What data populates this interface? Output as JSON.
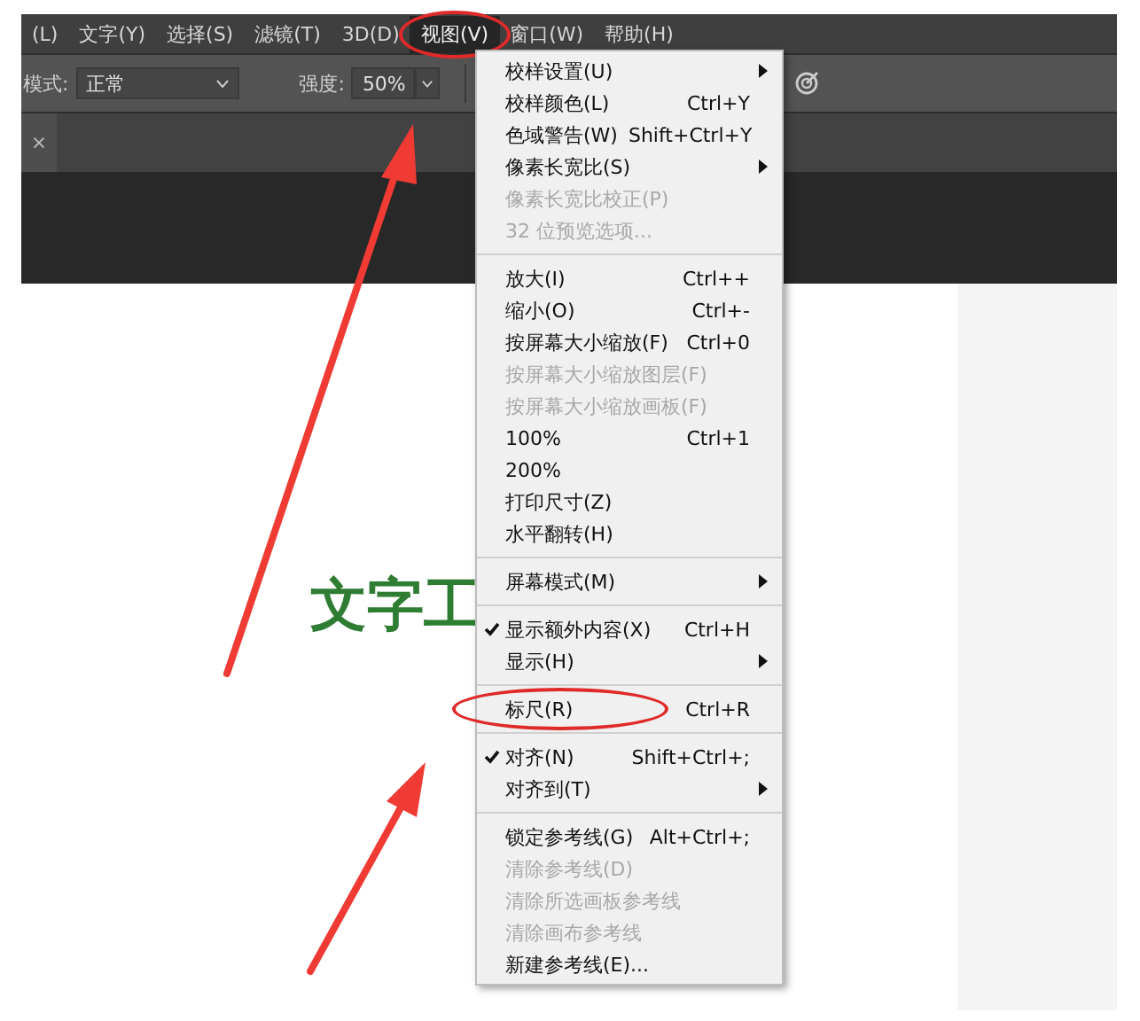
{
  "menu_bar": [
    {
      "label": "(L)",
      "selected": false,
      "circled": false
    },
    {
      "label": "文字(Y)",
      "selected": false,
      "circled": false
    },
    {
      "label": "选择(S)",
      "selected": false,
      "circled": false
    },
    {
      "label": "滤镜(T)",
      "selected": false,
      "circled": false
    },
    {
      "label": "3D(D)",
      "selected": false,
      "circled": false
    },
    {
      "label": "视图(V)",
      "selected": true,
      "circled": true
    },
    {
      "label": "窗口(W)",
      "selected": false,
      "circled": false
    },
    {
      "label": "帮助(H)",
      "selected": false,
      "circled": false
    }
  ],
  "options_bar": {
    "mode_label": "模式:",
    "mode_value": "正常",
    "strength_label": "强度:",
    "strength_value": "50%"
  },
  "document_tab": {
    "close": "×"
  },
  "canvas": {
    "text": "文字工"
  },
  "view_menu": [
    {
      "kind": "item",
      "label": "校样设置(U)",
      "submenu": true,
      "checked": false,
      "disabled": false,
      "circled": false
    },
    {
      "kind": "item",
      "label": "校样颜色(L)",
      "shortcut": "Ctrl+Y",
      "submenu": false,
      "checked": false,
      "disabled": false,
      "circled": false
    },
    {
      "kind": "item",
      "label": "色域警告(W)",
      "shortcut": "Shift+Ctrl+Y",
      "submenu": false,
      "checked": false,
      "disabled": false,
      "circled": false
    },
    {
      "kind": "item",
      "label": "像素长宽比(S)",
      "submenu": true,
      "checked": false,
      "disabled": false,
      "circled": false
    },
    {
      "kind": "item",
      "label": "像素长宽比校正(P)",
      "submenu": false,
      "checked": false,
      "disabled": true,
      "circled": false
    },
    {
      "kind": "item",
      "label": "32 位预览选项...",
      "submenu": false,
      "checked": false,
      "disabled": true,
      "circled": false
    },
    {
      "kind": "separator"
    },
    {
      "kind": "item",
      "label": "放大(I)",
      "shortcut": "Ctrl++",
      "submenu": false,
      "checked": false,
      "disabled": false,
      "circled": false
    },
    {
      "kind": "item",
      "label": "缩小(O)",
      "shortcut": "Ctrl+-",
      "submenu": false,
      "checked": false,
      "disabled": false,
      "circled": false
    },
    {
      "kind": "item",
      "label": "按屏幕大小缩放(F)",
      "shortcut": "Ctrl+0",
      "submenu": false,
      "checked": false,
      "disabled": false,
      "circled": false
    },
    {
      "kind": "item",
      "label": "按屏幕大小缩放图层(F)",
      "submenu": false,
      "checked": false,
      "disabled": true,
      "circled": false
    },
    {
      "kind": "item",
      "label": "按屏幕大小缩放画板(F)",
      "submenu": false,
      "checked": false,
      "disabled": true,
      "circled": false
    },
    {
      "kind": "item",
      "label": "100%",
      "shortcut": "Ctrl+1",
      "submenu": false,
      "checked": false,
      "disabled": false,
      "circled": false
    },
    {
      "kind": "item",
      "label": "200%",
      "submenu": false,
      "checked": false,
      "disabled": false,
      "circled": false
    },
    {
      "kind": "item",
      "label": "打印尺寸(Z)",
      "submenu": false,
      "checked": false,
      "disabled": false,
      "circled": false
    },
    {
      "kind": "item",
      "label": "水平翻转(H)",
      "submenu": false,
      "checked": false,
      "disabled": false,
      "circled": false
    },
    {
      "kind": "separator"
    },
    {
      "kind": "item",
      "label": "屏幕模式(M)",
      "submenu": true,
      "checked": false,
      "disabled": false,
      "circled": false
    },
    {
      "kind": "separator"
    },
    {
      "kind": "item",
      "label": "显示额外内容(X)",
      "shortcut": "Ctrl+H",
      "submenu": false,
      "checked": true,
      "disabled": false,
      "circled": false
    },
    {
      "kind": "item",
      "label": "显示(H)",
      "submenu": true,
      "checked": false,
      "disabled": false,
      "circled": false
    },
    {
      "kind": "separator"
    },
    {
      "kind": "item",
      "label": "标尺(R)",
      "shortcut": "Ctrl+R",
      "submenu": false,
      "checked": false,
      "disabled": false,
      "circled": true
    },
    {
      "kind": "separator"
    },
    {
      "kind": "item",
      "label": "对齐(N)",
      "shortcut": "Shift+Ctrl+;",
      "submenu": false,
      "checked": true,
      "disabled": false,
      "circled": false
    },
    {
      "kind": "item",
      "label": "对齐到(T)",
      "submenu": true,
      "checked": false,
      "disabled": false,
      "circled": false
    },
    {
      "kind": "separator"
    },
    {
      "kind": "item",
      "label": "锁定参考线(G)",
      "shortcut": "Alt+Ctrl+;",
      "submenu": false,
      "checked": false,
      "disabled": false,
      "circled": false
    },
    {
      "kind": "item",
      "label": "清除参考线(D)",
      "submenu": false,
      "checked": false,
      "disabled": true,
      "circled": false
    },
    {
      "kind": "item",
      "label": "清除所选画板参考线",
      "submenu": false,
      "checked": false,
      "disabled": true,
      "circled": false
    },
    {
      "kind": "item",
      "label": "清除画布参考线",
      "submenu": false,
      "checked": false,
      "disabled": true,
      "circled": false
    },
    {
      "kind": "item",
      "label": "新建参考线(E)...",
      "submenu": false,
      "checked": false,
      "disabled": false,
      "circled": false
    }
  ]
}
